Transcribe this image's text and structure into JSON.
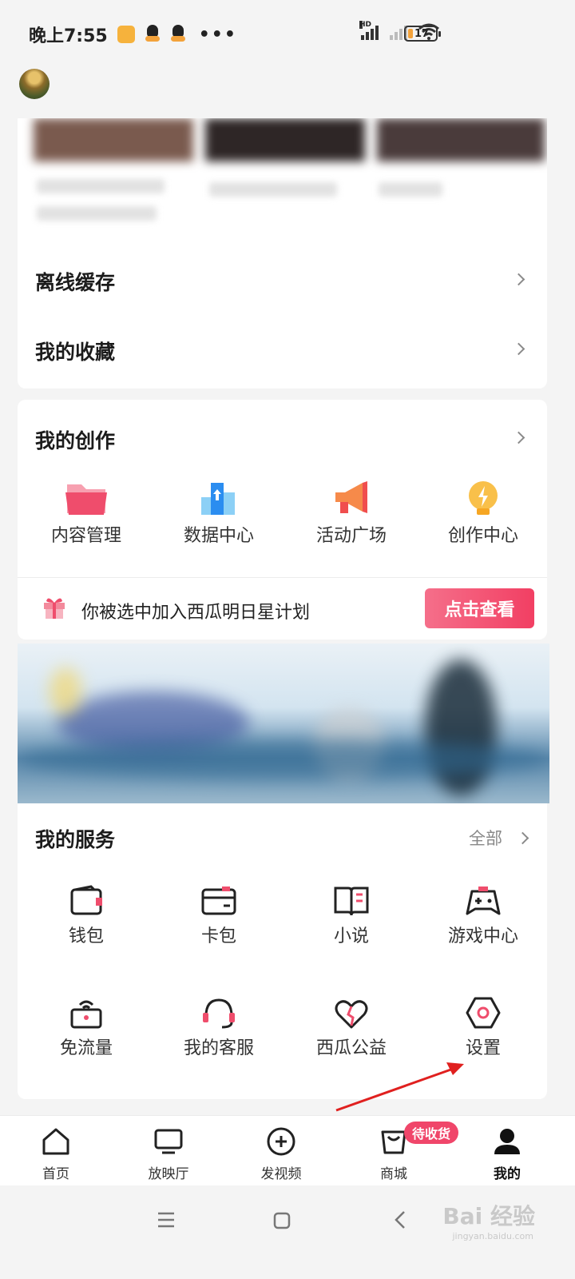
{
  "status_bar": {
    "time": "晚上7:55",
    "battery": "17",
    "signal_label": "HD"
  },
  "menu": [
    {
      "label": "离线缓存"
    },
    {
      "label": "我的收藏"
    }
  ],
  "creation": {
    "title": "我的创作",
    "items": [
      {
        "label": "内容管理",
        "icon": "folder-icon"
      },
      {
        "label": "数据中心",
        "icon": "data-chart-icon"
      },
      {
        "label": "活动广场",
        "icon": "megaphone-icon"
      },
      {
        "label": "创作中心",
        "icon": "lightbulb-icon"
      }
    ],
    "invite_text": "你被选中加入西瓜明日星计划",
    "invite_button": "点击查看"
  },
  "services": {
    "title": "我的服务",
    "all_label": "全部",
    "items": [
      {
        "label": "钱包",
        "icon": "wallet-icon"
      },
      {
        "label": "卡包",
        "icon": "card-icon"
      },
      {
        "label": "小说",
        "icon": "book-icon"
      },
      {
        "label": "游戏中心",
        "icon": "gamepad-icon"
      },
      {
        "label": "免流量",
        "icon": "router-icon"
      },
      {
        "label": "我的客服",
        "icon": "headset-icon"
      },
      {
        "label": "西瓜公益",
        "icon": "heart-icon"
      },
      {
        "label": "设置",
        "icon": "settings-hex-icon"
      }
    ]
  },
  "bottom_nav": {
    "items": [
      {
        "label": "首页",
        "icon": "home-icon"
      },
      {
        "label": "放映厅",
        "icon": "tv-icon"
      },
      {
        "label": "发视频",
        "icon": "plus-circle-icon"
      },
      {
        "label": "商城",
        "icon": "shopping-bag-icon"
      },
      {
        "label": "我的",
        "icon": "person-icon"
      }
    ],
    "badge": "待收货",
    "active": "我的"
  },
  "watermark": {
    "main": "Bai 经验",
    "sub": "jingyan.baidu.com"
  },
  "colors": {
    "accent": "#f0466a",
    "annotation_arrow": "#e0201f"
  }
}
